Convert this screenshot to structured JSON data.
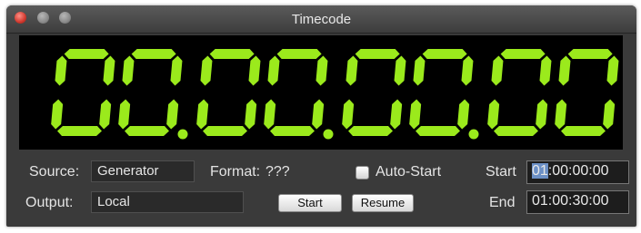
{
  "window": {
    "title": "Timecode"
  },
  "display": {
    "timecode": "00.00.00.00",
    "digits": [
      "0",
      "0",
      "0",
      "0",
      "0",
      "0",
      "0",
      "0"
    ],
    "segment_color": "#9bea1c",
    "background": "#000000"
  },
  "source": {
    "label": "Source:",
    "value": "Generator"
  },
  "format": {
    "label": "Format:",
    "value": "???"
  },
  "auto_start": {
    "label": "Auto-Start",
    "checked": false
  },
  "output": {
    "label": "Output:",
    "value": "Local"
  },
  "buttons": {
    "start": "Start",
    "resume": "Resume"
  },
  "start_time": {
    "label": "Start",
    "selected_part": "01",
    "rest": ":00:00:00"
  },
  "end_time": {
    "label": "End",
    "value": "01:00:30:00"
  }
}
